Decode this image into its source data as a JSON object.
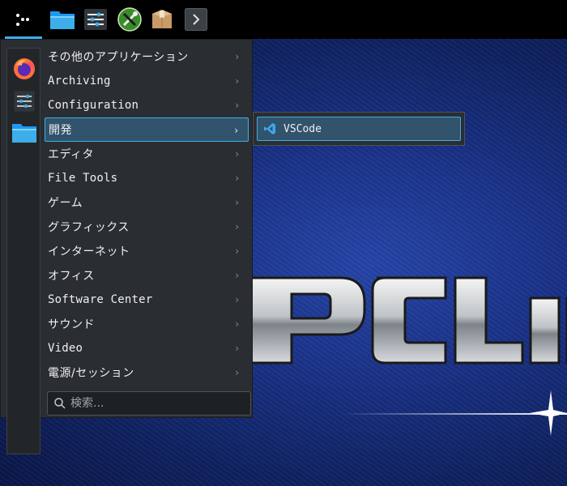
{
  "taskbar": {
    "launcher_icon": "app-launcher-icon",
    "pinned": [
      {
        "name": "file-manager-icon"
      },
      {
        "name": "settings-icon"
      },
      {
        "name": "tools-icon"
      },
      {
        "name": "package-icon"
      },
      {
        "name": "chevron-right-icon"
      }
    ]
  },
  "menu": {
    "favorites": [
      "firefox-icon",
      "settings-icon",
      "folder-icon"
    ],
    "categories": [
      {
        "label": "その他のアプリケーション"
      },
      {
        "label": "Archiving"
      },
      {
        "label": "Configuration"
      },
      {
        "label": "開発"
      },
      {
        "label": "エディタ"
      },
      {
        "label": "File Tools"
      },
      {
        "label": "ゲーム"
      },
      {
        "label": "グラフィックス"
      },
      {
        "label": "インターネット"
      },
      {
        "label": "オフィス"
      },
      {
        "label": "Software Center"
      },
      {
        "label": "サウンド"
      },
      {
        "label": "Video"
      },
      {
        "label": "電源/セッション"
      }
    ],
    "active_category": "開発",
    "search": {
      "placeholder": "検索...",
      "value": ""
    }
  },
  "submenu": {
    "items": [
      {
        "label": "VSCode",
        "icon": "vscode-icon"
      }
    ]
  },
  "colors": {
    "accent": "#3daee9",
    "highlight": "#31536c",
    "menu_bg": "#2a2e32",
    "taskbar_bg": "#000000"
  }
}
